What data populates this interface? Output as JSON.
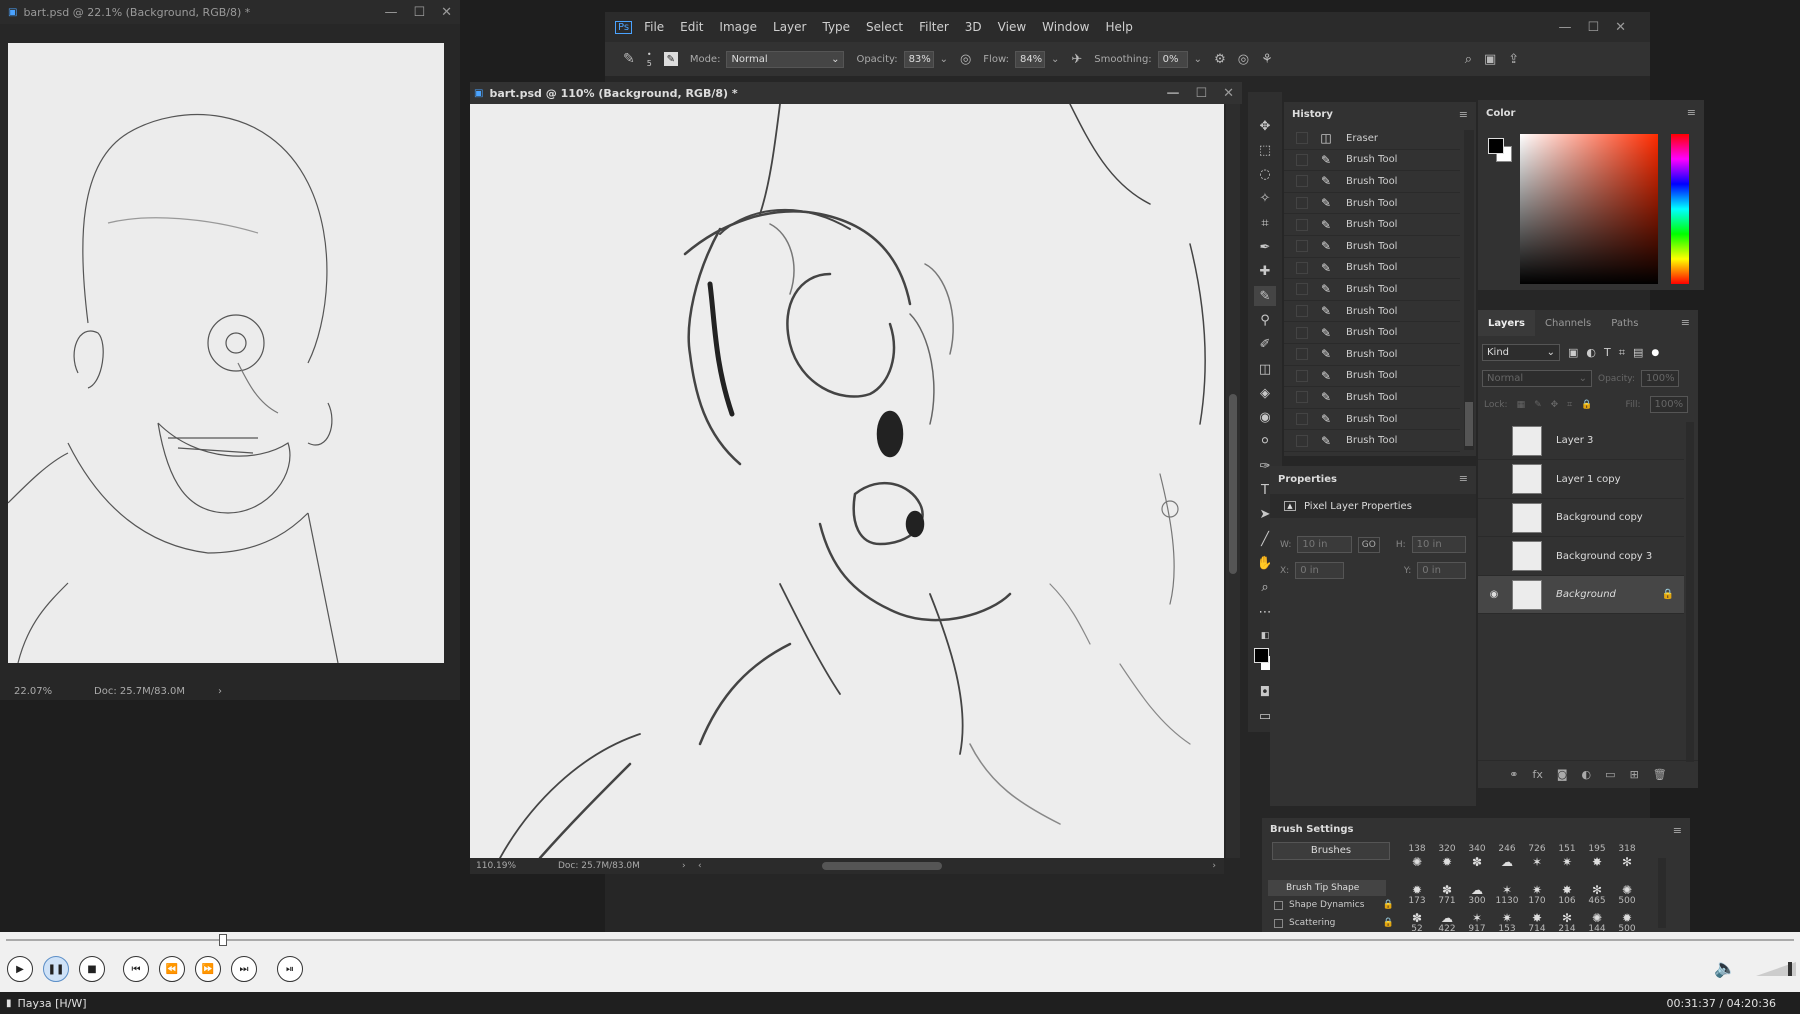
{
  "left_doc": {
    "title": "bart.psd @ 22.1% (Background, RGB/8) *",
    "zoom": "22.07%",
    "doc": "Doc: 25.7M/83.0M"
  },
  "ps": {
    "menu": [
      "File",
      "Edit",
      "Image",
      "Layer",
      "Type",
      "Select",
      "Filter",
      "3D",
      "View",
      "Window",
      "Help"
    ],
    "options": {
      "brush_size": "5",
      "mode_label": "Mode:",
      "mode_value": "Normal",
      "opacity_label": "Opacity:",
      "opacity_value": "83%",
      "flow_label": "Flow:",
      "flow_value": "84%",
      "smoothing_label": "Smoothing:",
      "smoothing_value": "0%"
    }
  },
  "main_doc": {
    "title": "bart.psd @ 110% (Background, RGB/8) *",
    "zoom": "110.19%",
    "doc": "Doc: 25.7M/83.0M"
  },
  "history": {
    "title": "History",
    "items": [
      "Eraser",
      "Brush Tool",
      "Brush Tool",
      "Brush Tool",
      "Brush Tool",
      "Brush Tool",
      "Brush Tool",
      "Brush Tool",
      "Brush Tool",
      "Brush Tool",
      "Brush Tool",
      "Brush Tool",
      "Brush Tool",
      "Brush Tool",
      "Brush Tool"
    ]
  },
  "properties": {
    "title": "Properties",
    "subtitle": "Pixel Layer Properties",
    "w_label": "W:",
    "w_value": "10 in",
    "h_label": "H:",
    "h_value": "10 in",
    "x_label": "X:",
    "x_value": "0 in",
    "y_label": "Y:",
    "y_value": "0 in",
    "link": "GO"
  },
  "color": {
    "title": "Color",
    "hue": "#ff2b00"
  },
  "layers": {
    "tabs": [
      "Layers",
      "Channels",
      "Paths"
    ],
    "kind": "Kind",
    "blend": "Normal",
    "opacity_label": "Opacity:",
    "opacity_value": "100%",
    "lock_label": "Lock:",
    "fill_label": "Fill:",
    "fill_value": "100%",
    "items": [
      "Layer 3",
      "Layer 1 copy",
      "Background copy",
      "Background copy 3",
      "Background"
    ]
  },
  "brush_settings": {
    "title": "Brush Settings",
    "brushes_btn": "Brushes",
    "tip_shape": "Brush Tip Shape",
    "shape_dynamics": "Shape Dynamics",
    "scattering": "Scattering",
    "row1": [
      "138",
      "320",
      "340",
      "246",
      "726",
      "151",
      "195",
      "318"
    ],
    "row2": [
      "173",
      "771",
      "300",
      "1130",
      "170",
      "106",
      "465",
      "500"
    ],
    "row3": [
      "52",
      "422",
      "917",
      "153",
      "714",
      "214",
      "144",
      "500"
    ]
  },
  "player": {
    "status": "Пауза [H/W]",
    "time": "00:31:37 / 04:20:36"
  }
}
